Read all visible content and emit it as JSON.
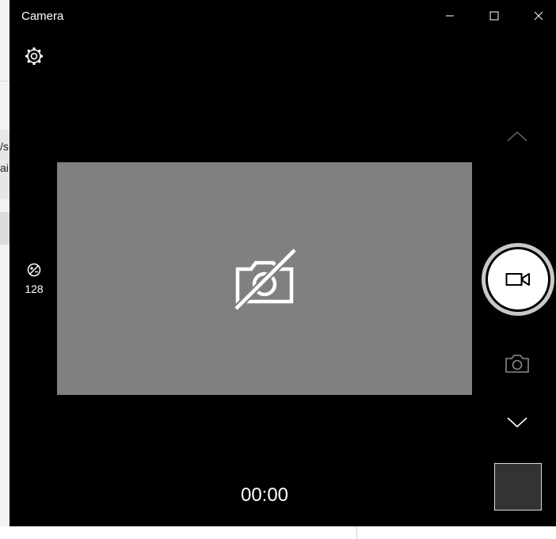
{
  "window": {
    "title": "Camera",
    "minimize_icon": "minimize-icon",
    "maximize_icon": "maximize-icon",
    "close_icon": "close-icon"
  },
  "background_window": {
    "line1": "/s",
    "line2": "ai"
  },
  "toolbar": {
    "settings_icon": "gear-icon"
  },
  "exposure": {
    "icon": "exposure-icon",
    "value": "128"
  },
  "preview": {
    "icon": "camera-off-icon",
    "background_color": "#808080"
  },
  "recording": {
    "timer": "00:00"
  },
  "controls": {
    "mode_up_icon": "chevron-up-icon",
    "record_icon": "video-camera-icon",
    "photo_icon": "camera-icon",
    "mode_down_icon": "chevron-down-icon"
  },
  "colors": {
    "window_bg": "#000000",
    "preview_bg": "#808080",
    "foreground": "#ffffff",
    "record_ring": "#c8c8c8",
    "thumbnail_bg": "#333333"
  }
}
